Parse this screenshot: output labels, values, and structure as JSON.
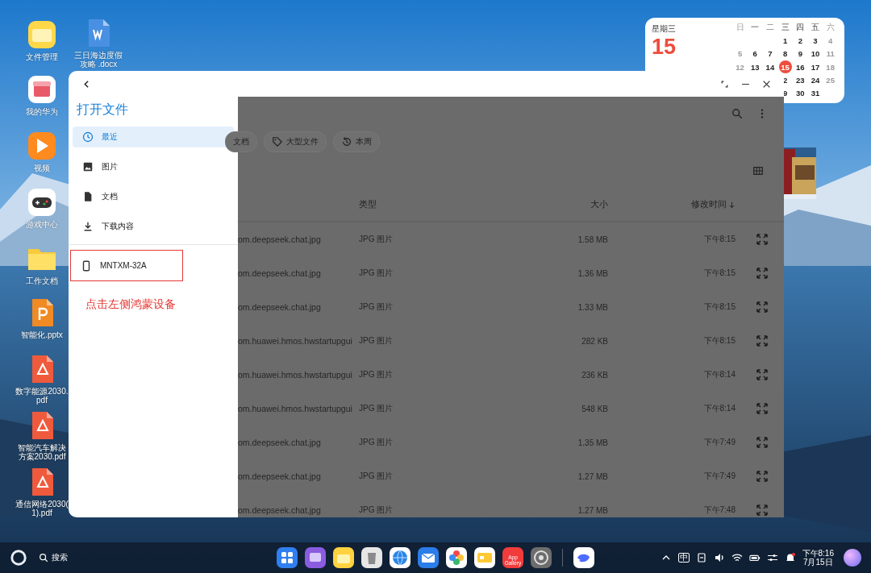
{
  "desktop_icons": [
    {
      "label": "文件管理",
      "kind": "files"
    },
    {
      "label": "三日海边度假攻略 .docx",
      "kind": "word"
    },
    {
      "label": "我的华为",
      "kind": "huawei"
    },
    {
      "label": "视频",
      "kind": "video"
    },
    {
      "label": "游戏中心",
      "kind": "game"
    },
    {
      "label": "工作文档",
      "kind": "folder"
    },
    {
      "label": "智能化.pptx",
      "kind": "ppt"
    },
    {
      "label": "数字能源2030.\npdf",
      "kind": "pdf"
    },
    {
      "label": "智能汽车解决方案2030.pdf",
      "kind": "pdf"
    },
    {
      "label": "通信网络2030(\n1).pdf",
      "kind": "pdf"
    }
  ],
  "calendar": {
    "weekday": "星期三",
    "date": "15",
    "headers": [
      {
        "label": "日"
      },
      {
        "label": "一"
      },
      {
        "label": "二"
      },
      {
        "label": "三"
      },
      {
        "label": "四"
      },
      {
        "label": "五"
      },
      {
        "label": "六"
      }
    ],
    "rows": [
      [
        null,
        null,
        null,
        {
          "day": "1",
          "selected": false
        },
        {
          "day": "2",
          "selected": false
        },
        {
          "day": "3",
          "selected": false
        },
        {
          "day": "4",
          "selected": false
        }
      ],
      [
        {
          "day": "5",
          "selected": false
        },
        {
          "day": "6",
          "selected": false
        },
        {
          "day": "7",
          "selected": false
        },
        {
          "day": "8",
          "selected": false
        },
        {
          "day": "9",
          "selected": false
        },
        {
          "day": "10",
          "selected": false
        },
        {
          "day": "11",
          "selected": false
        }
      ],
      [
        {
          "day": "12",
          "selected": false
        },
        {
          "day": "13",
          "selected": false
        },
        {
          "day": "14",
          "selected": false
        },
        {
          "day": "15",
          "selected": true
        },
        {
          "day": "16",
          "selected": false
        },
        {
          "day": "17",
          "selected": false
        },
        {
          "day": "18",
          "selected": false
        }
      ],
      [
        null,
        null,
        null,
        {
          "day": "2",
          "selected": false
        },
        {
          "day": "23",
          "selected": false
        },
        {
          "day": "24",
          "selected": false
        },
        {
          "day": "25",
          "selected": false
        }
      ],
      [
        null,
        null,
        null,
        {
          "day": "9",
          "selected": false
        },
        {
          "day": "30",
          "selected": false
        },
        {
          "day": "31",
          "selected": false
        },
        null
      ]
    ]
  },
  "dialog": {
    "title": "打开文件",
    "nav": [
      {
        "label": "最近",
        "selected": true
      },
      {
        "label": "图片",
        "selected": false
      },
      {
        "label": "文档",
        "selected": false
      },
      {
        "label": "下载内容",
        "selected": false
      }
    ],
    "devices": [
      {
        "label": "MNTXM-32A",
        "selected": false
      }
    ],
    "annotation": {
      "text": "点击左侧鸿蒙设备"
    },
    "filters": [
      {
        "label": "文档"
      },
      {
        "label": "大型文件"
      },
      {
        "label": "本周"
      }
    ],
    "columns": [
      {
        "label": "类型",
        "sorted": false
      },
      {
        "label": "大小",
        "sorted": false
      },
      {
        "label": "修改时间",
        "sorted": true
      }
    ],
    "rows": [
      {
        "name": "om.deepseek.chat.jpg",
        "type": "JPG 图片",
        "size": "1.58 MB",
        "modified": "下午8:15"
      },
      {
        "name": "om.deepseek.chat.jpg",
        "type": "JPG 图片",
        "size": "1.36 MB",
        "modified": "下午8:15"
      },
      {
        "name": "om.deepseek.chat.jpg",
        "type": "JPG 图片",
        "size": "1.33 MB",
        "modified": "下午8:15"
      },
      {
        "name": "om.huawei.hmos.hwstartupgui",
        "type": "JPG 图片",
        "size": "282 KB",
        "modified": "下午8:15"
      },
      {
        "name": "om.huawei.hmos.hwstartupgui",
        "type": "JPG 图片",
        "size": "236 KB",
        "modified": "下午8:14"
      },
      {
        "name": "om.huawei.hmos.hwstartupgui",
        "type": "JPG 图片",
        "size": "548 KB",
        "modified": "下午8:14"
      },
      {
        "name": "om.deepseek.chat.jpg",
        "type": "JPG 图片",
        "size": "1.35 MB",
        "modified": "下午7:49"
      },
      {
        "name": "om.deepseek.chat.jpg",
        "type": "JPG 图片",
        "size": "1.27 MB",
        "modified": "下午7:49"
      },
      {
        "name": "om.deepseek.chat.jpg",
        "type": "JPG 图片",
        "size": "1.27 MB",
        "modified": "下午7:48"
      }
    ]
  },
  "taskbar": {
    "search": "搜索",
    "apps": [
      {
        "kind": "launcher"
      },
      {
        "kind": "windows"
      },
      {
        "kind": "notes"
      },
      {
        "kind": "trash"
      },
      {
        "kind": "browser"
      },
      {
        "kind": "mail"
      },
      {
        "kind": "gallery"
      },
      {
        "kind": "cards"
      },
      {
        "kind": "store",
        "label": "App\nGallery"
      },
      {
        "kind": "settings"
      },
      {
        "kind": "whale"
      }
    ],
    "ime": "中",
    "time": "下午8:16",
    "date": "7月15日"
  }
}
